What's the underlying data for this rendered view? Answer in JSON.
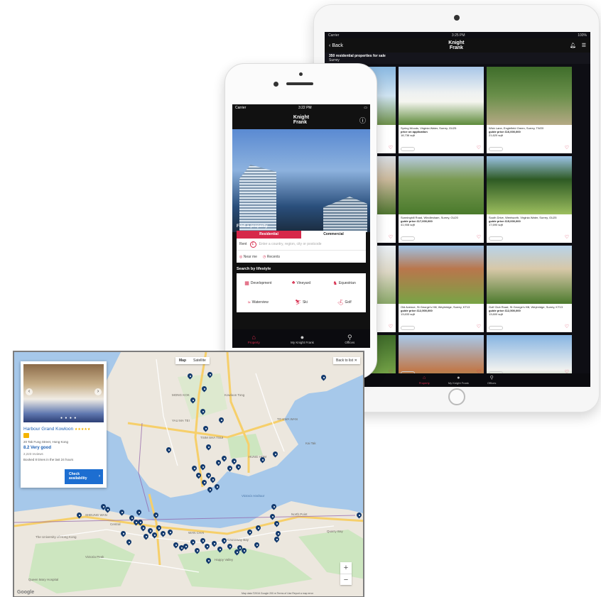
{
  "ipad": {
    "status": {
      "carrier": "Carrier",
      "time": "3:25 PM",
      "battery": "100%"
    },
    "nav": {
      "back_label": "Back",
      "logo_line1": "Knight",
      "logo_line2": "Frank"
    },
    "results_title": "350 residential properties for sale",
    "results_sub": "Surrey",
    "listings": [
      {
        "address": "lee Lane, Surrey, GU25",
        "price": "",
        "size": "",
        "photo": "ph1"
      },
      {
        "address": "Spring Woods, Virginia Water, Surrey, GU25",
        "price": "price on application",
        "size": "18,736 sqft",
        "photo": "ph2"
      },
      {
        "address": "Wick Lane, Englefield Green, Surrey, TW20",
        "price": "guide price £16,000,000",
        "size": "21,620 sqft",
        "photo": "ph3"
      },
      {
        "address": "",
        "price": "",
        "size": "",
        "photo": "ph4"
      },
      {
        "address": "Sunninghill Road, Windlesham, Surrey, GU20",
        "price": "guide price £17,000,000",
        "size": "41,908 sqft",
        "photo": "ph5"
      },
      {
        "address": "South Drive, Wentworth, Virginia Water, Surrey, GU25",
        "price": "guide price £15,000,000",
        "size": "17,690 sqft",
        "photo": "ph6"
      },
      {
        "address": "Surrey, KT13",
        "price": "",
        "size": "",
        "photo": "ph7"
      },
      {
        "address": "Old Avenue, St George's Hill, Weybridge, Surrey, KT13",
        "price": "guide price £12,500,000",
        "size": "13,633 sqft",
        "photo": "ph8"
      },
      {
        "address": "Golf Club Road, St George's Hill, Weybridge, Surrey, KT13",
        "price": "guide price £12,500,000",
        "size": "13,600 sqft",
        "photo": "ph9"
      },
      {
        "address": "",
        "price": "",
        "size": "",
        "photo": "ph10"
      },
      {
        "address": "",
        "price": "",
        "size": "",
        "photo": "ph11"
      },
      {
        "address": "",
        "price": "",
        "size": "",
        "photo": "ph12"
      }
    ],
    "tabs": [
      {
        "label": "Property",
        "icon": "home-icon"
      },
      {
        "label": "My Knight Frank",
        "icon": "user-icon"
      },
      {
        "label": "Offices",
        "icon": "location-icon"
      }
    ]
  },
  "iphone": {
    "status": {
      "carrier": "Carrier",
      "time": "3:22 PM"
    },
    "logo_line1": "Knight",
    "logo_line2": "Frank",
    "find_label": "Find a property",
    "segments": {
      "residential": "Residential",
      "commercial": "Commercial"
    },
    "search": {
      "mode": "Rent",
      "placeholder": "Enter a country, region, city or postcode",
      "near_me": "Near me",
      "recents": "Recents"
    },
    "lifestyle_title": "Search by lifestyle",
    "lifestyle": [
      {
        "label": "Development",
        "icon": "building-icon"
      },
      {
        "label": "Vineyard",
        "icon": "grapes-icon"
      },
      {
        "label": "Equestrian",
        "icon": "horse-icon"
      },
      {
        "label": "Waterview",
        "icon": "wave-icon"
      },
      {
        "label": "Ski",
        "icon": "ski-icon"
      },
      {
        "label": "Golf",
        "icon": "golf-icon"
      }
    ],
    "tabs": [
      {
        "label": "Property",
        "icon": "home-icon"
      },
      {
        "label": "My Knight Frank",
        "icon": "user-icon"
      },
      {
        "label": "Offices",
        "icon": "location-icon"
      }
    ]
  },
  "map": {
    "type_toggle": {
      "map": "Map",
      "satellite": "Satellite"
    },
    "back_to_list": "Back to list",
    "zoom_in": "+",
    "zoom_out": "−",
    "google": "Google",
    "footer": "Map data ©2016 Google   200 m   Terms of Use   Report a map error",
    "labels": {
      "tsim": "TSIM SHA TSUI",
      "kowloon": "Kowloon Tong",
      "kai_tak": "Kai Tak",
      "harbour": "Victoria Harbour",
      "central": "Central",
      "wan_chai": "WAN CHAI",
      "causeway": "Causeway Bay",
      "sheung_wan": "SHEUNG WAN",
      "peak": "Victoria Peak",
      "university": "The University of Hong Kong",
      "north_point": "North Point",
      "happy_valley": "Happy Valley",
      "quarry_bay": "Quarry Bay",
      "queen_mary": "Queen Mary Hospital",
      "mong_kok": "MONG KOK",
      "yau_ma_tei": "YAU MA TEI",
      "hung_hom": "HUNG HOM",
      "to_kwa_wan": "TO KWA WAN"
    },
    "hotel": {
      "name": "Harbour Grand Kowloon",
      "stars": "★★★★★",
      "address": "20 Tak Fung Street, Hong Kong",
      "score": "8.2 Very good",
      "reviews": "2,223 reviews",
      "booked": "Booked 8 times in the last 24 hours",
      "button_line1": "Check",
      "button_line2": "availability",
      "photo_dots": "● ● ● ●"
    }
  },
  "colors": {
    "brand_red": "#d6284a",
    "pin_navy": "#133a6e",
    "water": "#a6c8ea",
    "park": "#cde6c0",
    "road": "#f6cf6a"
  }
}
